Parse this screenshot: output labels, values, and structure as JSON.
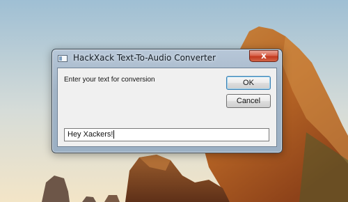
{
  "window": {
    "title": "HackXack Text-To-Audio Converter",
    "close_label": "x"
  },
  "dialog": {
    "prompt": "Enter your text for conversion",
    "ok_label": "OK",
    "cancel_label": "Cancel",
    "input_value": "Hey Xackers!"
  },
  "icons": {
    "app": "app-window-icon",
    "close": "close-icon"
  },
  "colors": {
    "sky_top": "#a9c3d6",
    "sky_bottom": "#f1e6cf",
    "rock": "#c9752f",
    "window_frame": "#a2b4c6",
    "close_button": "#c2391f"
  }
}
